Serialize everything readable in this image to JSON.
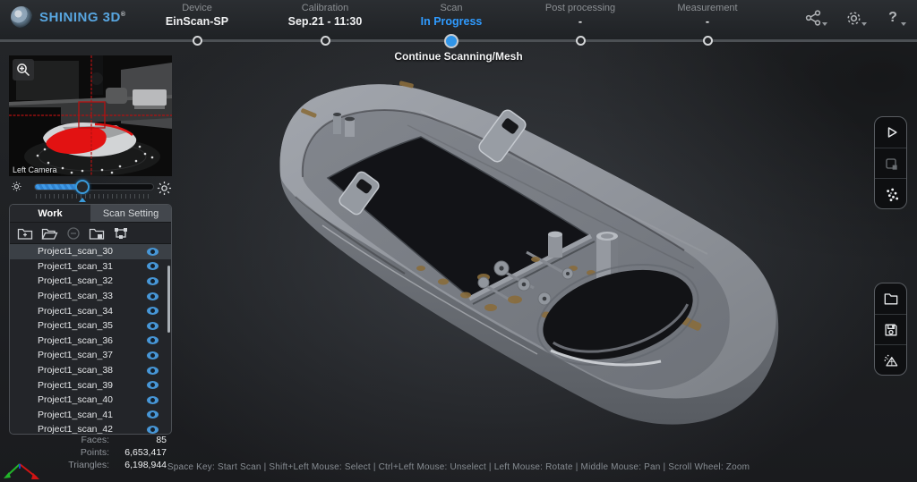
{
  "topbar": {
    "brand": "SHINING 3D",
    "brand_reg": "®",
    "steps": [
      {
        "label": "Device",
        "value": "EinScan-SP",
        "state": "done"
      },
      {
        "label": "Calibration",
        "value": "Sep.21 - 11:30",
        "state": "done"
      },
      {
        "label": "Scan",
        "value": "In Progress",
        "state": "active"
      },
      {
        "label": "Post processing",
        "value": "-",
        "state": "pending"
      },
      {
        "label": "Measurement",
        "value": "-",
        "state": "pending"
      }
    ],
    "icons": [
      "share-icon",
      "settings-gear-icon",
      "help-icon"
    ]
  },
  "progress": {
    "subtitle": "Continue Scanning/Mesh"
  },
  "camera": {
    "label": "Left Camera",
    "zoom_icon": "magnifier-icon",
    "brightness_icons": [
      "sun-dim-icon",
      "sun-bright-icon"
    ],
    "brightness_pct": 40
  },
  "work_panel": {
    "tabs": [
      {
        "label": "Work",
        "active": true
      },
      {
        "label": "Scan Setting",
        "active": false
      }
    ],
    "toolbar_icons": [
      "new-project-icon",
      "open-project-icon",
      "remove-scan-icon",
      "save-project-icon",
      "align-icon"
    ],
    "selected_index": 0,
    "scans": [
      {
        "name": "Project1_scan_30",
        "visible": true
      },
      {
        "name": "Project1_scan_31",
        "visible": true
      },
      {
        "name": "Project1_scan_32",
        "visible": true
      },
      {
        "name": "Project1_scan_33",
        "visible": true
      },
      {
        "name": "Project1_scan_34",
        "visible": true
      },
      {
        "name": "Project1_scan_35",
        "visible": true
      },
      {
        "name": "Project1_scan_36",
        "visible": true
      },
      {
        "name": "Project1_scan_37",
        "visible": true
      },
      {
        "name": "Project1_scan_38",
        "visible": true
      },
      {
        "name": "Project1_scan_39",
        "visible": true
      },
      {
        "name": "Project1_scan_40",
        "visible": true
      },
      {
        "name": "Project1_scan_41",
        "visible": true
      },
      {
        "name": "Project1_scan_42",
        "visible": true
      }
    ]
  },
  "stats": {
    "rows": [
      {
        "label": "Faces:",
        "value": "85"
      },
      {
        "label": "Points:",
        "value": "6,653,417"
      },
      {
        "label": "Triangles:",
        "value": "6,198,944"
      }
    ]
  },
  "hint": "Space Key: Start Scan | Shift+Left Mouse: Select | Ctrl+Left Mouse: Unselect | Left Mouse: Rotate | Middle Mouse: Pan | Scroll Wheel: Zoom",
  "right_toolbar": {
    "top_icons": [
      "start-scan-play-icon",
      "select-region-icon",
      "point-cloud-icon"
    ],
    "bottom_icons": [
      "open-folder-icon",
      "save-icon",
      "mesh-icon"
    ]
  },
  "colors": {
    "accent_blue": "#2f9bff",
    "brand_blue": "#58a6e0",
    "scan_highlight_red": "#e21212",
    "eye_blue": "#4796d6"
  }
}
